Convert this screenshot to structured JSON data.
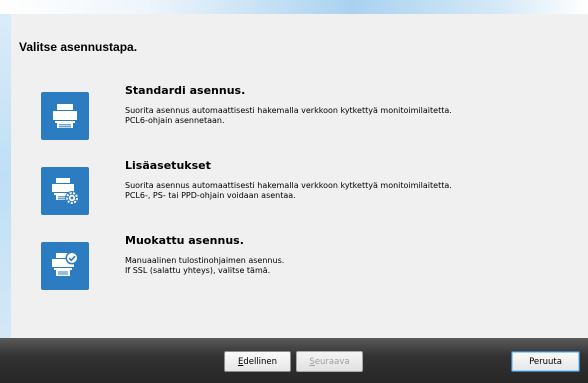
{
  "dialog": {
    "title": "Valitse asennustapa."
  },
  "options": [
    {
      "icon": "printer-icon",
      "title": "Standardi asennus.",
      "desc1": "Suorita asennus automaattisesti hakemalla verkkoon kytkettyä monitoimilaitetta.",
      "desc2": "PCL6-ohjain asennetaan."
    },
    {
      "icon": "printer-settings-icon",
      "title": "Lisäasetukset",
      "desc1": "Suorita asennus automaattisesti hakemalla verkkoon kytkettyä monitoimilaitetta.",
      "desc2": "PCL6-, PS- tai PPD-ohjain voidaan asentaa."
    },
    {
      "icon": "printer-check-icon",
      "title": "Muokattu asennus.",
      "desc1": "Manuaalinen tulostinohjaimen asennus.",
      "desc2": "If SSL (salattu yhteys), valitse tämä."
    }
  ],
  "buttons": {
    "back_first": "E",
    "back_rest": "dellinen",
    "next_first": "S",
    "next_rest": "euraava",
    "cancel": "Peruuta"
  },
  "colors": {
    "tile": "#2c7cc2",
    "panel": "#f0f0f0",
    "footer": "#333333"
  }
}
